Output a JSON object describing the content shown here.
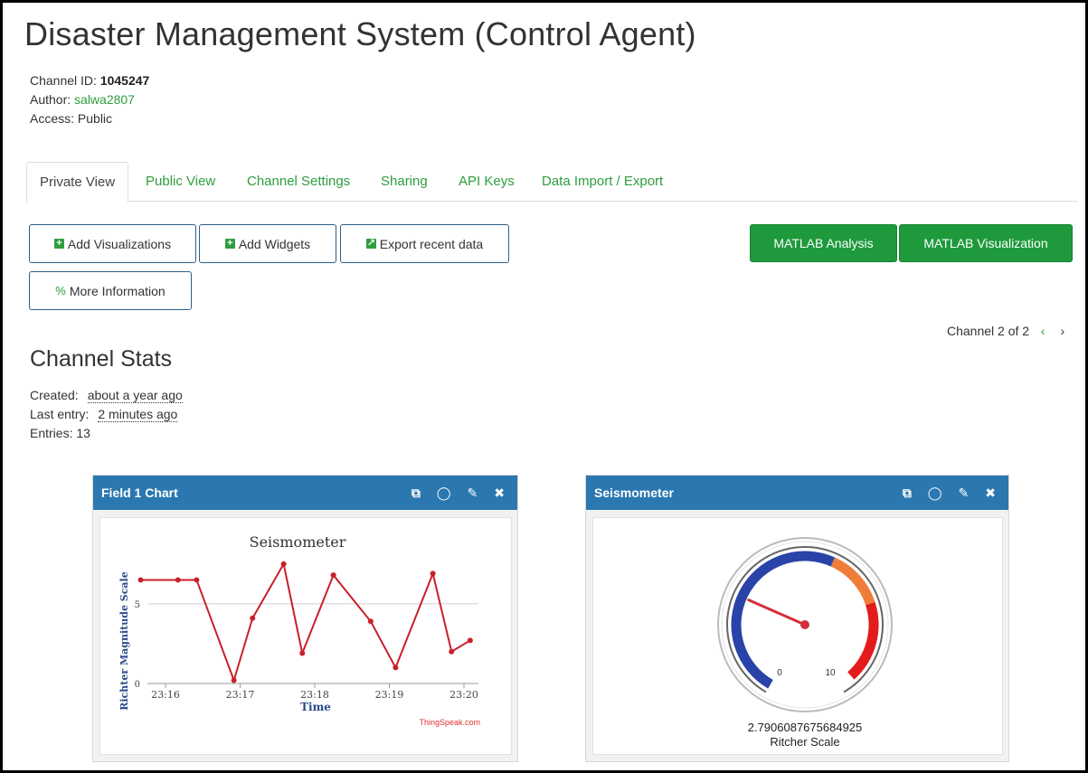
{
  "page": {
    "title": "Disaster Management System (Control Agent)"
  },
  "channel": {
    "id_label": "Channel ID:",
    "id_value": "1045247",
    "author_label": "Author:",
    "author_value": "salwa2807",
    "access_label": "Access:",
    "access_value": "Public"
  },
  "tabs": [
    {
      "label": "Private View",
      "active": true
    },
    {
      "label": "Public View"
    },
    {
      "label": "Channel Settings"
    },
    {
      "label": "Sharing"
    },
    {
      "label": "API Keys"
    },
    {
      "label": "Data Import / Export"
    }
  ],
  "buttons": {
    "add_visualizations": "Add Visualizations",
    "add_widgets": "Add Widgets",
    "export_recent": "Export recent data",
    "more_info": "More Information",
    "matlab_analysis": "MATLAB Analysis",
    "matlab_visualization": "MATLAB Visualization"
  },
  "channel_nav": {
    "text": "Channel 2 of 2",
    "prev": "‹",
    "next": "›"
  },
  "stats": {
    "title": "Channel Stats",
    "created_label": "Created:",
    "created_value": "about a year ago",
    "last_entry_label": "Last entry:",
    "last_entry_value": "2 minutes ago",
    "entries_label": "Entries:",
    "entries_value": "13"
  },
  "widgets": {
    "field_chart": {
      "header": "Field 1 Chart",
      "icons": [
        "external-link-icon",
        "comment-icon",
        "pencil-icon",
        "close-icon"
      ]
    },
    "seismometer": {
      "header": "Seismometer",
      "icons": [
        "external-link-icon",
        "comment-icon",
        "pencil-icon",
        "close-icon"
      ],
      "gauge_min": "0",
      "gauge_max": "10",
      "value": 2.7906087675684925,
      "value_text": "2.7906087675684925",
      "unit": "Ritcher Scale",
      "colors": {
        "blue_band": "#2a43a8",
        "orange_band": "#ef7d3a",
        "red_band": "#e31b1b",
        "needle": "#d32f3b"
      }
    }
  },
  "chart_data": {
    "type": "line",
    "title": "Seismometer",
    "xlabel": "Time",
    "ylabel": "Richter Magnitude Scale",
    "x_ticks": [
      "23:16",
      "23:17",
      "23:18",
      "23:19",
      "23:20"
    ],
    "y_ticks": [
      "0",
      "5"
    ],
    "ylim": [
      0,
      8
    ],
    "line_color": "#c8202a",
    "credit": "ThingSpeak.com",
    "points": [
      {
        "x": "23:15:40",
        "y": 6.5
      },
      {
        "x": "23:16:10",
        "y": 6.5
      },
      {
        "x": "23:16:25",
        "y": 6.5
      },
      {
        "x": "23:16:55",
        "y": 0.2
      },
      {
        "x": "23:17:10",
        "y": 4.1
      },
      {
        "x": "23:17:35",
        "y": 7.5
      },
      {
        "x": "23:17:50",
        "y": 1.9
      },
      {
        "x": "23:18:15",
        "y": 6.8
      },
      {
        "x": "23:18:45",
        "y": 3.9
      },
      {
        "x": "23:19:05",
        "y": 1.0
      },
      {
        "x": "23:19:35",
        "y": 6.9
      },
      {
        "x": "23:19:50",
        "y": 2.0
      },
      {
        "x": "23:20:05",
        "y": 2.7
      }
    ]
  }
}
